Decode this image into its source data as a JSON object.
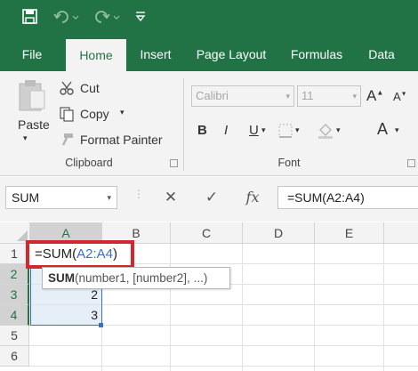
{
  "qat": {
    "save_icon": "save-icon",
    "undo_icon": "undo-icon",
    "redo_icon": "redo-icon",
    "customize_icon": "customize-qat-icon"
  },
  "tabs": [
    "File",
    "Home",
    "Insert",
    "Page Layout",
    "Formulas",
    "Data"
  ],
  "active_tab": "Home",
  "clipboard": {
    "paste": "Paste",
    "cut": "Cut",
    "copy": "Copy",
    "format_painter": "Format Painter",
    "label": "Clipboard"
  },
  "font": {
    "name": "Calibri",
    "size": "11",
    "bold": "B",
    "italic": "I",
    "underline": "U",
    "label": "Font",
    "font_color_glyph": "A"
  },
  "formula_bar": {
    "name_box": "SUM",
    "cancel": "✕",
    "enter": "✓",
    "fx": "fx",
    "formula": "=SUM(A2:A4)"
  },
  "grid": {
    "columns": [
      "A",
      "B",
      "C",
      "D",
      "E"
    ],
    "rows": [
      "1",
      "2",
      "3",
      "4",
      "5",
      "6"
    ],
    "cells": {
      "A3": "2",
      "A4": "3"
    },
    "editing": {
      "prefix": "=SUM(",
      "ref": "A2:A4",
      "suffix": ")"
    },
    "tooltip": {
      "fn": "SUM",
      "args": "(number1, [number2], ...)"
    }
  },
  "colors": {
    "brand": "#217346",
    "highlight_border": "#d1272e",
    "reference": "#3b6fc2"
  }
}
